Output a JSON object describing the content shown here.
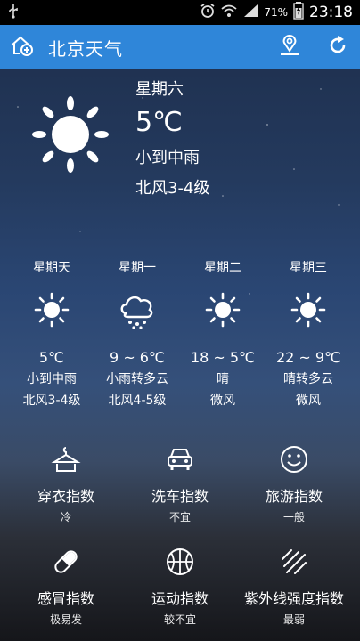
{
  "status_bar": {
    "left_icons": [
      "usb-icon"
    ],
    "right_icons": [
      "alarm-icon",
      "wifi-icon",
      "signal-icon",
      "battery-icon"
    ],
    "battery": "71%",
    "time": "23:18"
  },
  "app_bar": {
    "title": "北京天气",
    "accent": "#2f86d9"
  },
  "current": {
    "day": "星期六",
    "temp": "5℃",
    "condition": "小到中雨",
    "wind": "北风3-4级",
    "icon": "sun-icon"
  },
  "forecast": [
    {
      "day": "星期天",
      "icon": "sun-icon",
      "temp": "5℃",
      "condition": "小到中雨",
      "wind": "北风3-4级"
    },
    {
      "day": "星期一",
      "icon": "rain-cloud-icon",
      "temp": "9 ~ 6℃",
      "condition": "小雨转多云",
      "wind": "北风4-5级"
    },
    {
      "day": "星期二",
      "icon": "sun-icon",
      "temp": "18 ~ 5℃",
      "condition": "晴",
      "wind": "微风"
    },
    {
      "day": "星期三",
      "icon": "sun-icon",
      "temp": "22 ~ 9℃",
      "condition": "晴转多云",
      "wind": "微风"
    }
  ],
  "indices": [
    {
      "name": "穿衣指数",
      "value": "冷",
      "icon": "clothes-hanger-icon"
    },
    {
      "name": "洗车指数",
      "value": "不宜",
      "icon": "car-icon"
    },
    {
      "name": "旅游指数",
      "value": "一般",
      "icon": "smiley-icon"
    },
    {
      "name": "感冒指数",
      "value": "极易发",
      "icon": "pill-icon"
    },
    {
      "name": "运动指数",
      "value": "较不宜",
      "icon": "ball-icon"
    },
    {
      "name": "紫外线强度指数",
      "value": "最弱",
      "icon": "uv-rays-icon"
    }
  ]
}
